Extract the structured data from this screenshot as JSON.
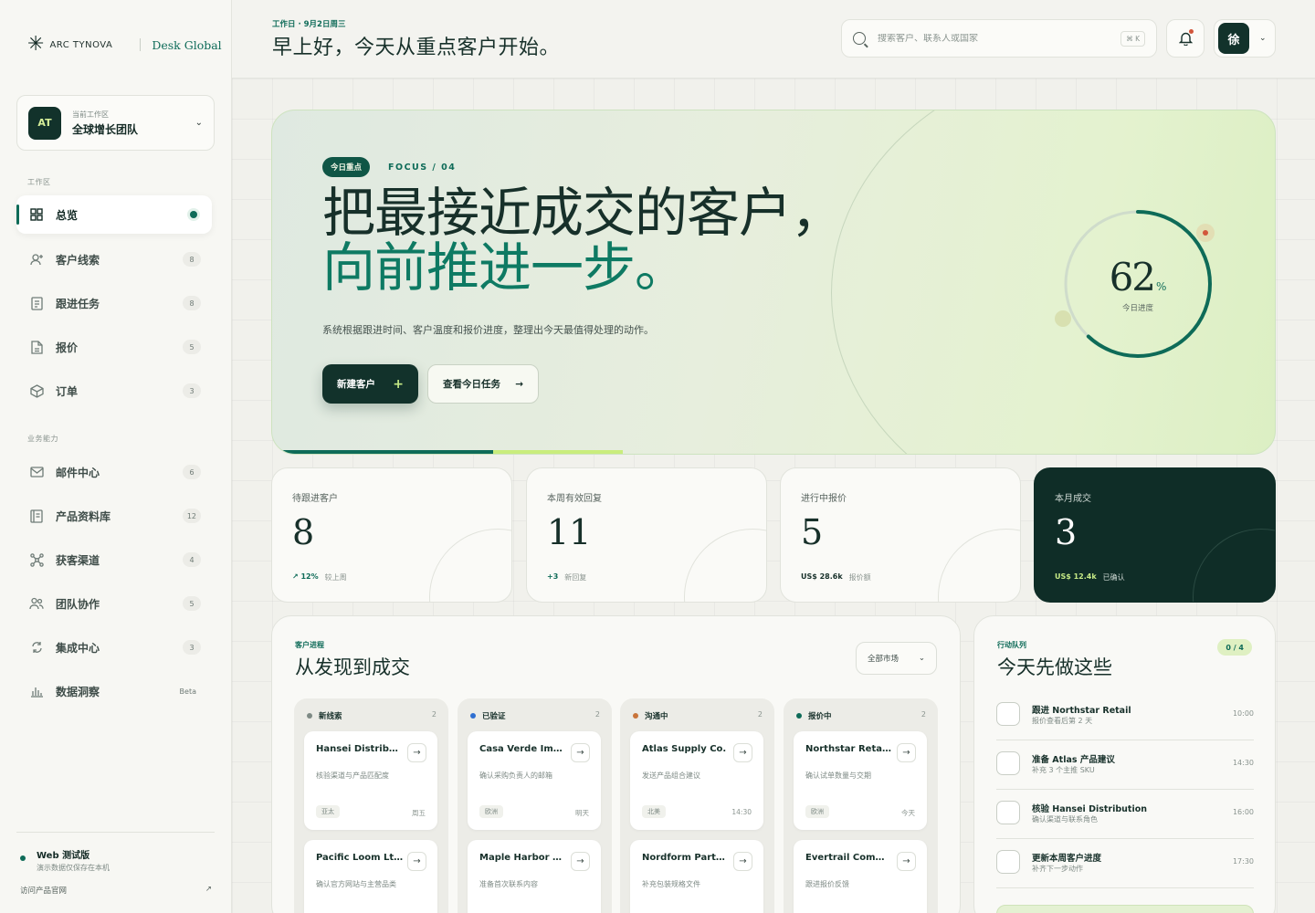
{
  "brand": {
    "mark": "✳",
    "name": "ARC TYNOVA",
    "product": "Desk Global"
  },
  "workspace": {
    "avatar": "AT",
    "label": "当前工作区",
    "name": "全球增长团队"
  },
  "nav": {
    "section1": "工作区",
    "section2": "业务能力",
    "items": [
      {
        "label": "总览",
        "icon": "grid-icon",
        "badge": ""
      },
      {
        "label": "客户线索",
        "icon": "user-plus-icon",
        "badge": "8"
      },
      {
        "label": "跟进任务",
        "icon": "task-list-icon",
        "badge": "8"
      },
      {
        "label": "报价",
        "icon": "document-icon",
        "badge": "5"
      },
      {
        "label": "订单",
        "icon": "box-icon",
        "badge": "3"
      },
      {
        "label": "邮件中心",
        "icon": "mail-icon",
        "badge": "6"
      },
      {
        "label": "产品资料库",
        "icon": "library-icon",
        "badge": "12"
      },
      {
        "label": "获客渠道",
        "icon": "network-icon",
        "badge": "4"
      },
      {
        "label": "团队协作",
        "icon": "team-icon",
        "badge": "5"
      },
      {
        "label": "集成中心",
        "icon": "sync-icon",
        "badge": "3"
      },
      {
        "label": "数据洞察",
        "icon": "bar-chart-icon",
        "badge": "Beta"
      }
    ]
  },
  "footer": {
    "title": "Web 测试版",
    "subtitle": "演示数据仅保存在本机",
    "link": "访问产品官网",
    "link_icon": "↗"
  },
  "topbar": {
    "date": "工作日 · 9月2日周三",
    "greeting": "早上好，今天从重点客户开始。",
    "search_placeholder": "搜索客户、联系人或国家",
    "kbd": "⌘ K",
    "user_initial": "徐"
  },
  "hero": {
    "chip": "今日重点",
    "focus": "FOCUS / 04",
    "line1": "把最接近成交的客户，",
    "line2": "向前推进一步。",
    "desc": "系统根据跟进时间、客户温度和报价进度，整理出今天最值得处理的动作。",
    "primary_btn": "新建客户",
    "primary_icon": "+",
    "secondary_btn": "查看今日任务",
    "secondary_icon": "→",
    "progress_value": "62",
    "progress_unit": "%",
    "progress_label": "今日进度",
    "progress_fraction": 0.62,
    "accent": "#0e6b58"
  },
  "stats": [
    {
      "label": "待跟进客户",
      "value": "8",
      "foot_strong": "↗ 12%",
      "foot": "较上周"
    },
    {
      "label": "本周有效回复",
      "value": "11",
      "foot_strong": "+3",
      "foot": "新回复"
    },
    {
      "label": "进行中报价",
      "value": "5",
      "foot_strong": "US$ 28.6k",
      "foot": "报价额"
    },
    {
      "label": "本月成交",
      "value": "3",
      "foot_strong": "US$ 12.4k",
      "foot": "已确认"
    }
  ],
  "pipeline": {
    "kicker": "客户进程",
    "title": "从发现到成交",
    "filter": "全部市场",
    "lanes": [
      {
        "name": "新线索",
        "count": "2",
        "color": "#7e8a85",
        "deals": [
          {
            "name": "Hansei Distribu…",
            "desc": "核验渠道与产品匹配度",
            "region": "亚太",
            "time": "周五"
          },
          {
            "name": "Pacific Loom Ltd.",
            "desc": "确认官方网站与主营品类",
            "region": "",
            "time": ""
          }
        ]
      },
      {
        "name": "已验证",
        "count": "2",
        "color": "#2f6fd1",
        "deals": [
          {
            "name": "Casa Verde Imp…",
            "desc": "确认采购负责人的邮箱",
            "region": "欧洲",
            "time": "明天"
          },
          {
            "name": "Maple Harbor T…",
            "desc": "准备首次联系内容",
            "region": "",
            "time": ""
          }
        ]
      },
      {
        "name": "沟通中",
        "count": "2",
        "color": "#c9743a",
        "deals": [
          {
            "name": "Atlas Supply Co.",
            "desc": "发送产品组合建议",
            "region": "北美",
            "time": "14:30"
          },
          {
            "name": "Nordform Part…",
            "desc": "补充包装规格文件",
            "region": "",
            "time": ""
          }
        ]
      },
      {
        "name": "报价中",
        "count": "2",
        "color": "#0e6b58",
        "deals": [
          {
            "name": "Northstar Retai…",
            "desc": "确认试单数量与交期",
            "region": "欧洲",
            "time": "今天"
          },
          {
            "name": "Evertrail Comm…",
            "desc": "跟进报价反馈",
            "region": "",
            "time": ""
          }
        ]
      }
    ]
  },
  "todo": {
    "kicker": "行动队列",
    "title": "今天先做这些",
    "count": "0 / 4",
    "items": [
      {
        "title": "跟进 Northstar Retail",
        "sub": "报价查看后第 2 天",
        "time": "10:00"
      },
      {
        "title": "准备 Atlas 产品建议",
        "sub": "补充 3 个主推 SKU",
        "time": "14:30"
      },
      {
        "title": "核验 Hansei Distribution",
        "sub": "确认渠道与联系角色",
        "time": "16:00"
      },
      {
        "title": "更新本周客户进度",
        "sub": "补齐下一步动作",
        "time": "17:30"
      }
    ]
  }
}
